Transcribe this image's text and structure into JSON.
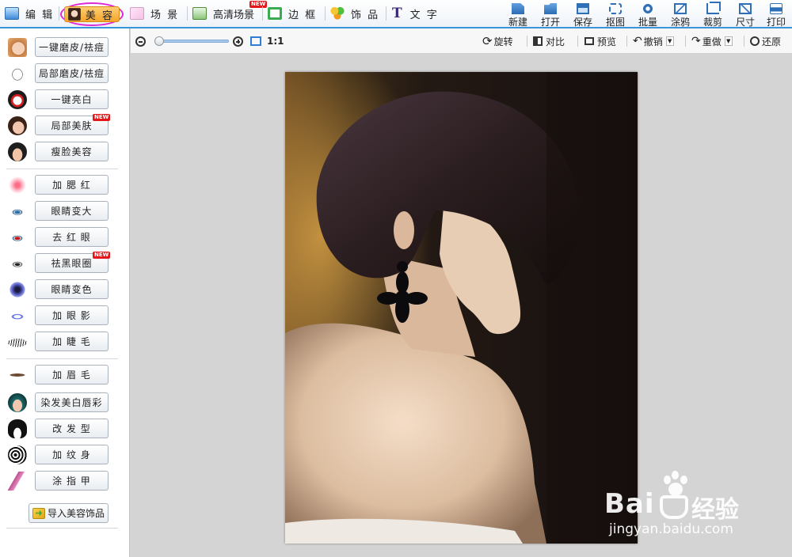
{
  "menu": {
    "tabs": [
      {
        "label": "编 辑"
      },
      {
        "label": "美 容",
        "active": true
      },
      {
        "label": "场 景"
      },
      {
        "label": "高清场景",
        "badge": "NEW"
      },
      {
        "label": "边 框"
      },
      {
        "label": "饰 品"
      },
      {
        "label": "文 字"
      }
    ],
    "tools": [
      "新建",
      "打开",
      "保存",
      "抠图",
      "批量",
      "涂鸦",
      "裁剪",
      "尺寸",
      "打印"
    ]
  },
  "sidebar": {
    "items": [
      {
        "label": "一键磨皮/祛痘",
        "icon": "face-icon"
      },
      {
        "label": "局部磨皮/祛痘",
        "icon": "face-sketch-icon"
      },
      {
        "label": "一键亮白",
        "icon": "opera-mask-icon"
      },
      {
        "label": "局部美肤",
        "icon": "woman-face-icon",
        "badge": "NEW"
      },
      {
        "label": "瘦脸美容",
        "icon": "man-face-icon"
      },
      {
        "label": "加 腮 红",
        "icon": "blush-icon"
      },
      {
        "label": "眼睛变大",
        "icon": "eye-blue-icon"
      },
      {
        "label": "去 红 眼",
        "icon": "eye-red-icon"
      },
      {
        "label": "祛黑眼圈",
        "icon": "eye-dark-icon",
        "badge": "NEW"
      },
      {
        "label": "眼睛变色",
        "icon": "iris-icon"
      },
      {
        "label": "加 眼 影",
        "icon": "eyeshadow-icon"
      },
      {
        "label": "加 睫 毛",
        "icon": "eyelash-icon"
      },
      {
        "label": "加 眉 毛",
        "icon": "eyebrow-icon"
      },
      {
        "label": "染发美白唇彩",
        "icon": "hair-color-icon"
      },
      {
        "label": "改 发 型",
        "icon": "hairstyle-icon"
      },
      {
        "label": "加 纹 身",
        "icon": "tattoo-icon"
      },
      {
        "label": "涂 指 甲",
        "icon": "nail-icon"
      }
    ],
    "import_label": "导入美容饰品"
  },
  "editbar": {
    "zoom_ratio": "1:1",
    "zoom_level": 0.05,
    "actions": [
      "旋转",
      "对比",
      "预览",
      "撤销",
      "重做",
      "还原"
    ]
  },
  "watermark": {
    "brand": "Bai",
    "brand_cn": "经验",
    "url": "jingyan.baidu.com"
  },
  "colors": {
    "accent": "#3a95d8",
    "highlight_ellipse": "#e02ad7",
    "active_tab": "#f4a62d"
  }
}
